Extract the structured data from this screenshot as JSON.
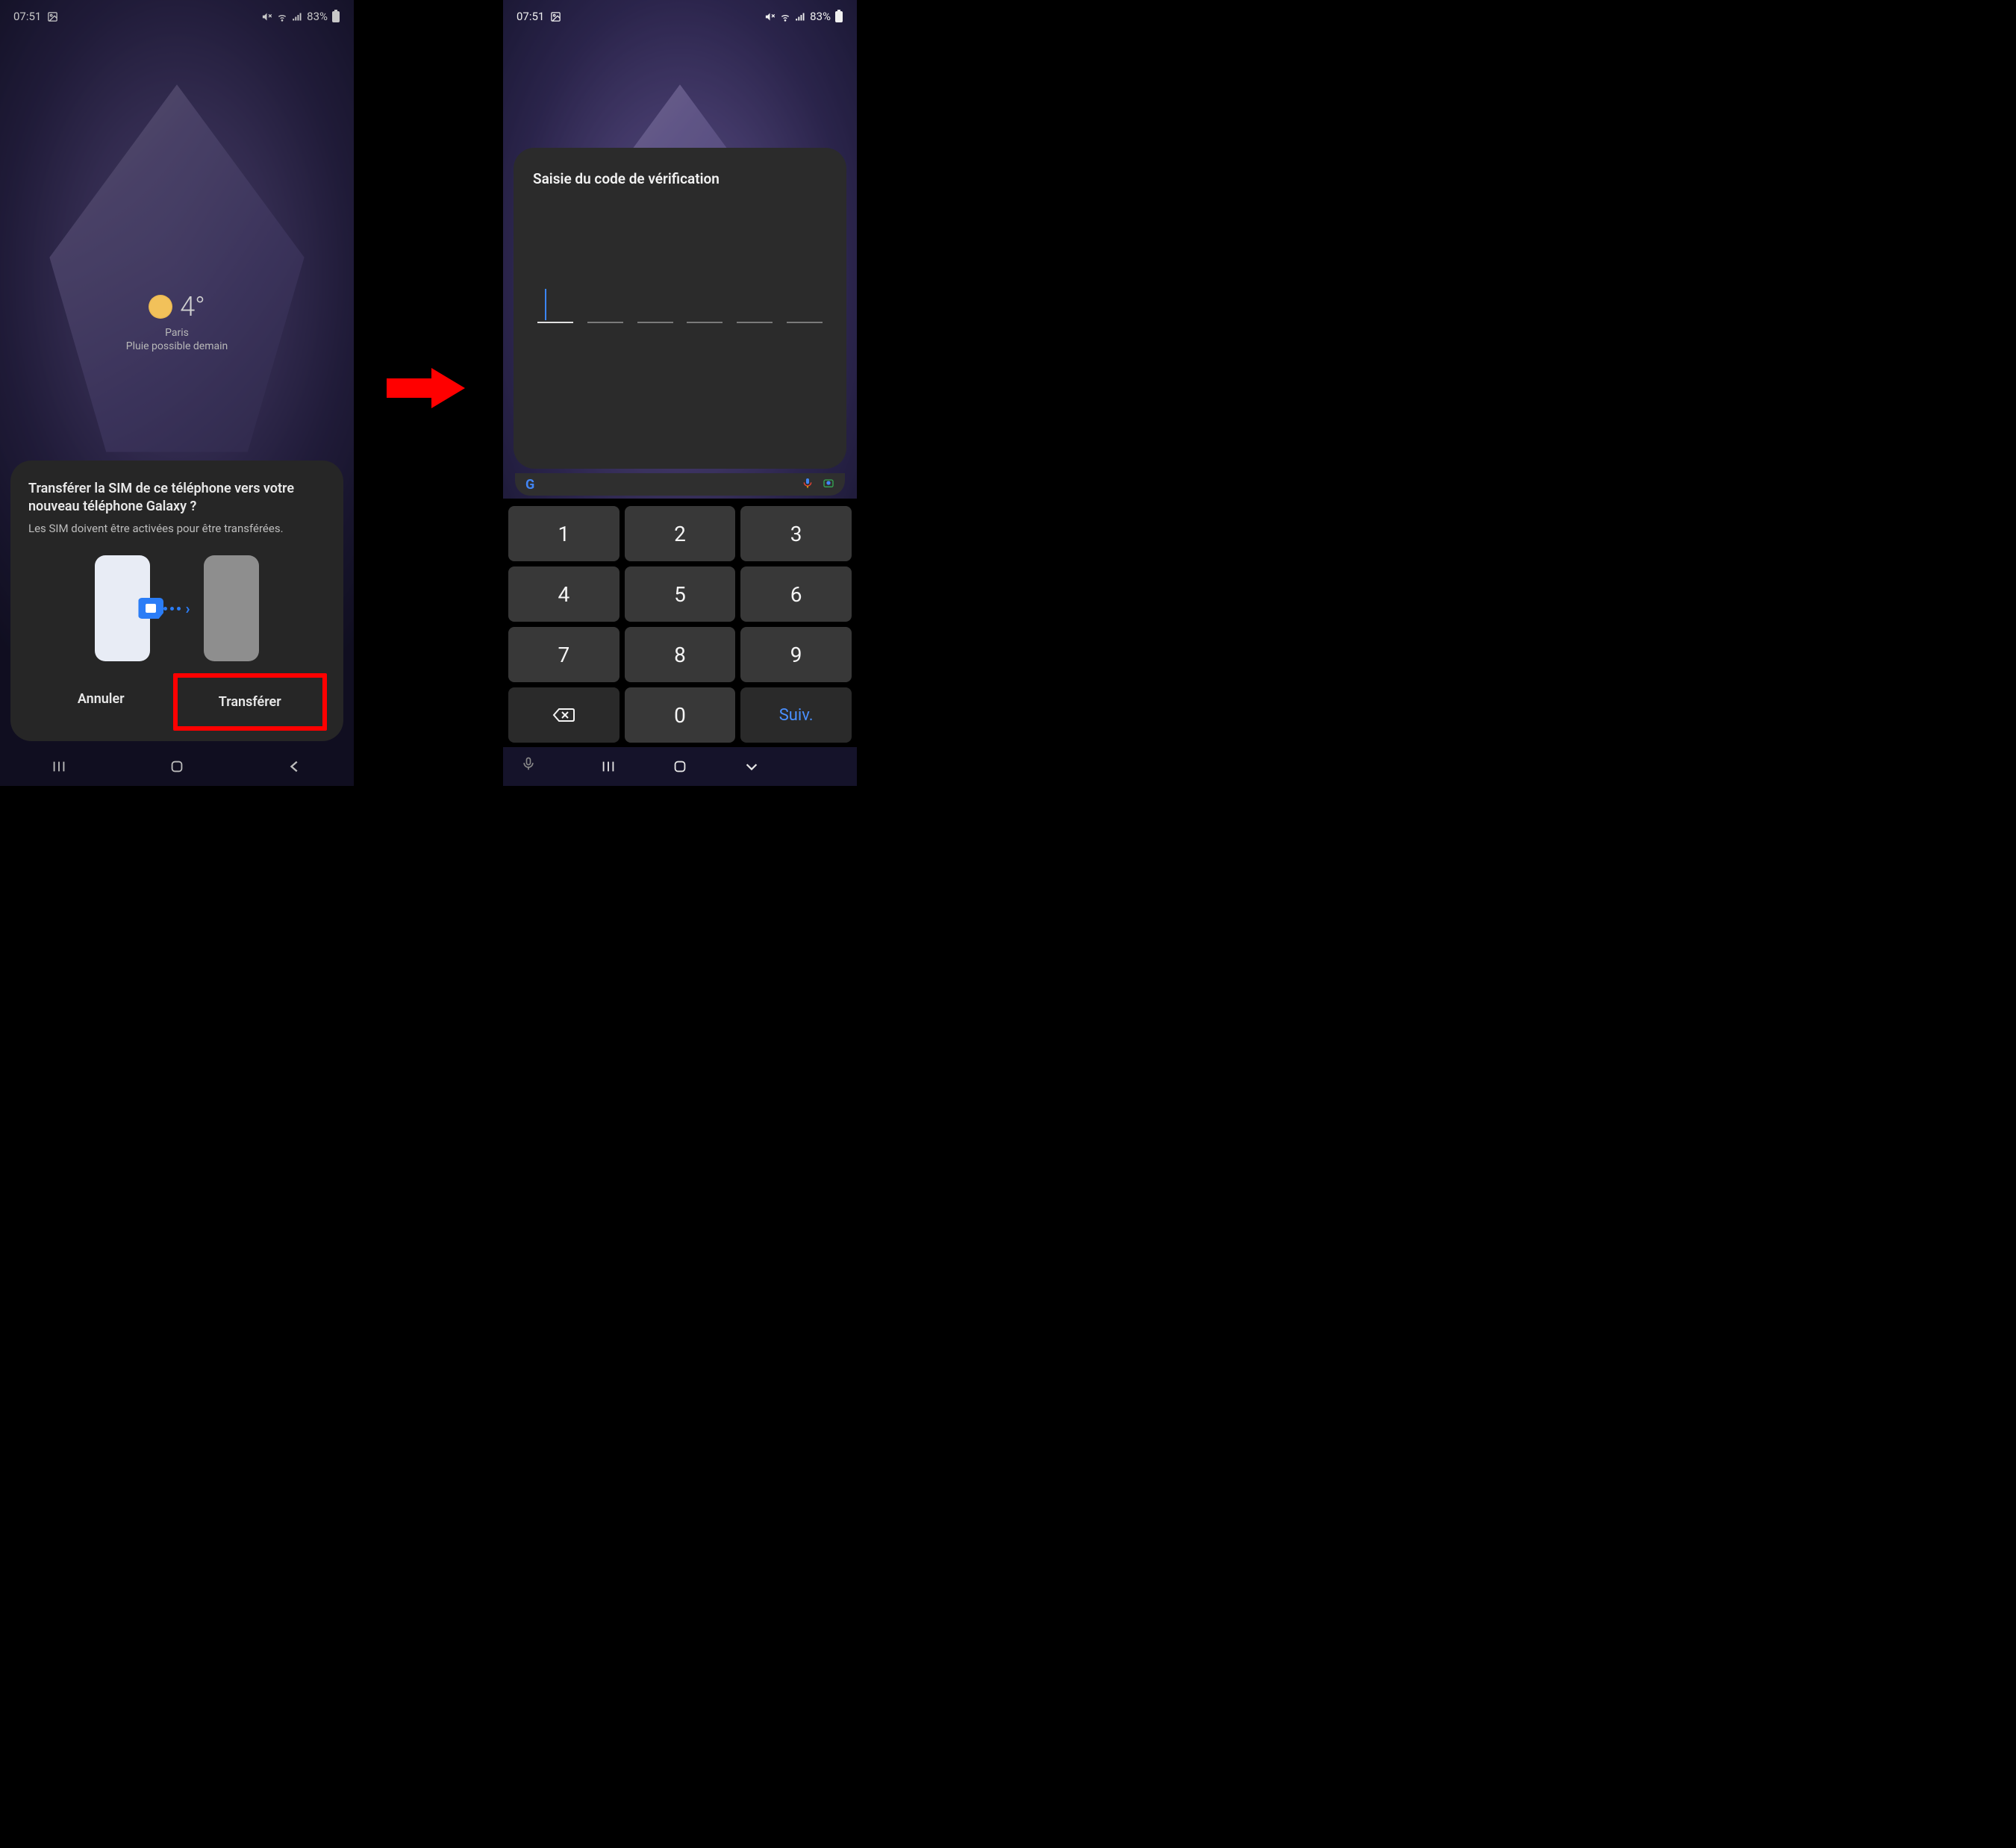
{
  "statusbar": {
    "time": "07:51",
    "battery": "83%"
  },
  "weather": {
    "temp": "4°",
    "city": "Paris",
    "forecast": "Pluie possible demain"
  },
  "transfer_dialog": {
    "title": "Transférer la SIM de ce téléphone vers votre nouveau téléphone Galaxy ?",
    "subtitle": "Les SIM doivent être activées pour être transférées.",
    "cancel": "Annuler",
    "confirm": "Transférer"
  },
  "verification": {
    "title": "Saisie du code de vérification",
    "slots": 6
  },
  "keypad": {
    "keys": [
      "1",
      "2",
      "3",
      "4",
      "5",
      "6",
      "7",
      "8",
      "9"
    ],
    "zero": "0",
    "next": "Suiv."
  }
}
